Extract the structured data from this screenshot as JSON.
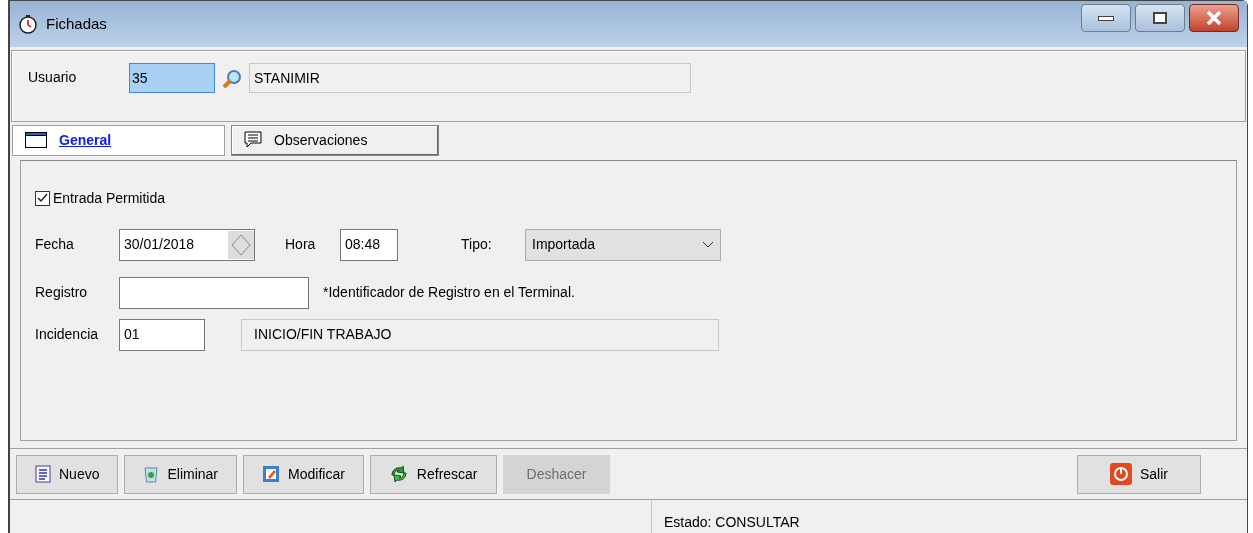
{
  "window": {
    "title": "Fichadas"
  },
  "user": {
    "label": "Usuario",
    "code": "35",
    "name": "STANIMIR"
  },
  "tabs": [
    {
      "label": "General",
      "selected": true,
      "kind": "window"
    },
    {
      "label": "Observaciones",
      "selected": false,
      "kind": "comment"
    }
  ],
  "form": {
    "permitted": {
      "label": "Entrada Permitida",
      "checked": true
    },
    "date": {
      "label": "Fecha",
      "value": "30/01/2018"
    },
    "time": {
      "label": "Hora",
      "value": "08:48"
    },
    "type": {
      "label": "Tipo:",
      "value": "Importada"
    },
    "record": {
      "label": "Registro",
      "note": "*Identificador de Registro en el Terminal."
    },
    "incident": {
      "label": "Incidencia",
      "code": "01",
      "name": "INICIO/FIN TRABAJO"
    }
  },
  "buttons": [
    {
      "label": "Nuevo",
      "kind": "new",
      "disabled": false
    },
    {
      "label": "Eliminar",
      "kind": "delete",
      "disabled": false
    },
    {
      "label": "Modificar",
      "kind": "edit",
      "disabled": false
    },
    {
      "label": "Refrescar",
      "kind": "refresh",
      "disabled": false
    },
    {
      "label": "Deshacer",
      "kind": "undo",
      "disabled": true
    }
  ],
  "exit_button": {
    "label": "Salir"
  },
  "status_bar": {
    "state": "Estado: CONSULTAR"
  }
}
